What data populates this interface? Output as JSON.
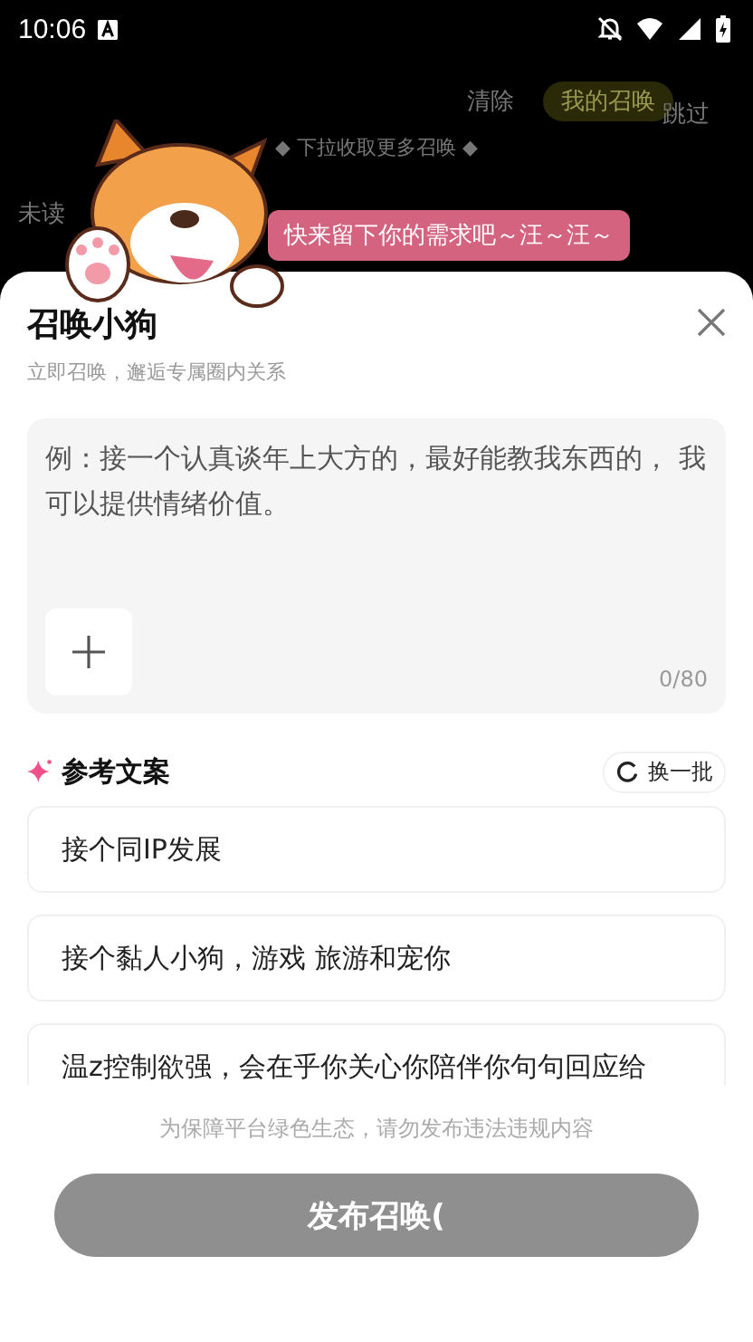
{
  "status_bar": {
    "time": "10:06"
  },
  "background": {
    "clear": "清除",
    "my_summons": "我的召唤",
    "skip": "跳过",
    "pull_hint": "◆ 下拉收取更多召唤 ◆",
    "unread": "未读"
  },
  "mascot": {
    "speech": "快来留下你的需求吧～汪～汪～"
  },
  "sheet": {
    "title": "召唤小狗",
    "subtitle": "立即召唤，邂逅专属圈内关系",
    "input": {
      "placeholder": "例：接一个认真谈年上大方的，最好能教我东西的， 我可以提供情绪价值。",
      "counter": "0/80"
    },
    "references": {
      "title": "参考文案",
      "refresh": "换一批",
      "items": [
        {
          "text": "接个同IP发展"
        },
        {
          "text": "接个黏人小狗，游戏 旅游和宠你"
        },
        {
          "text": "温z控制欲强，会在乎你关心你陪伴你句句回应给"
        }
      ]
    },
    "notice": "为保障平台绿色生态，请勿发布违法违规内容",
    "submit": {
      "label": "发布召唤(",
      "disabled": true
    }
  }
}
